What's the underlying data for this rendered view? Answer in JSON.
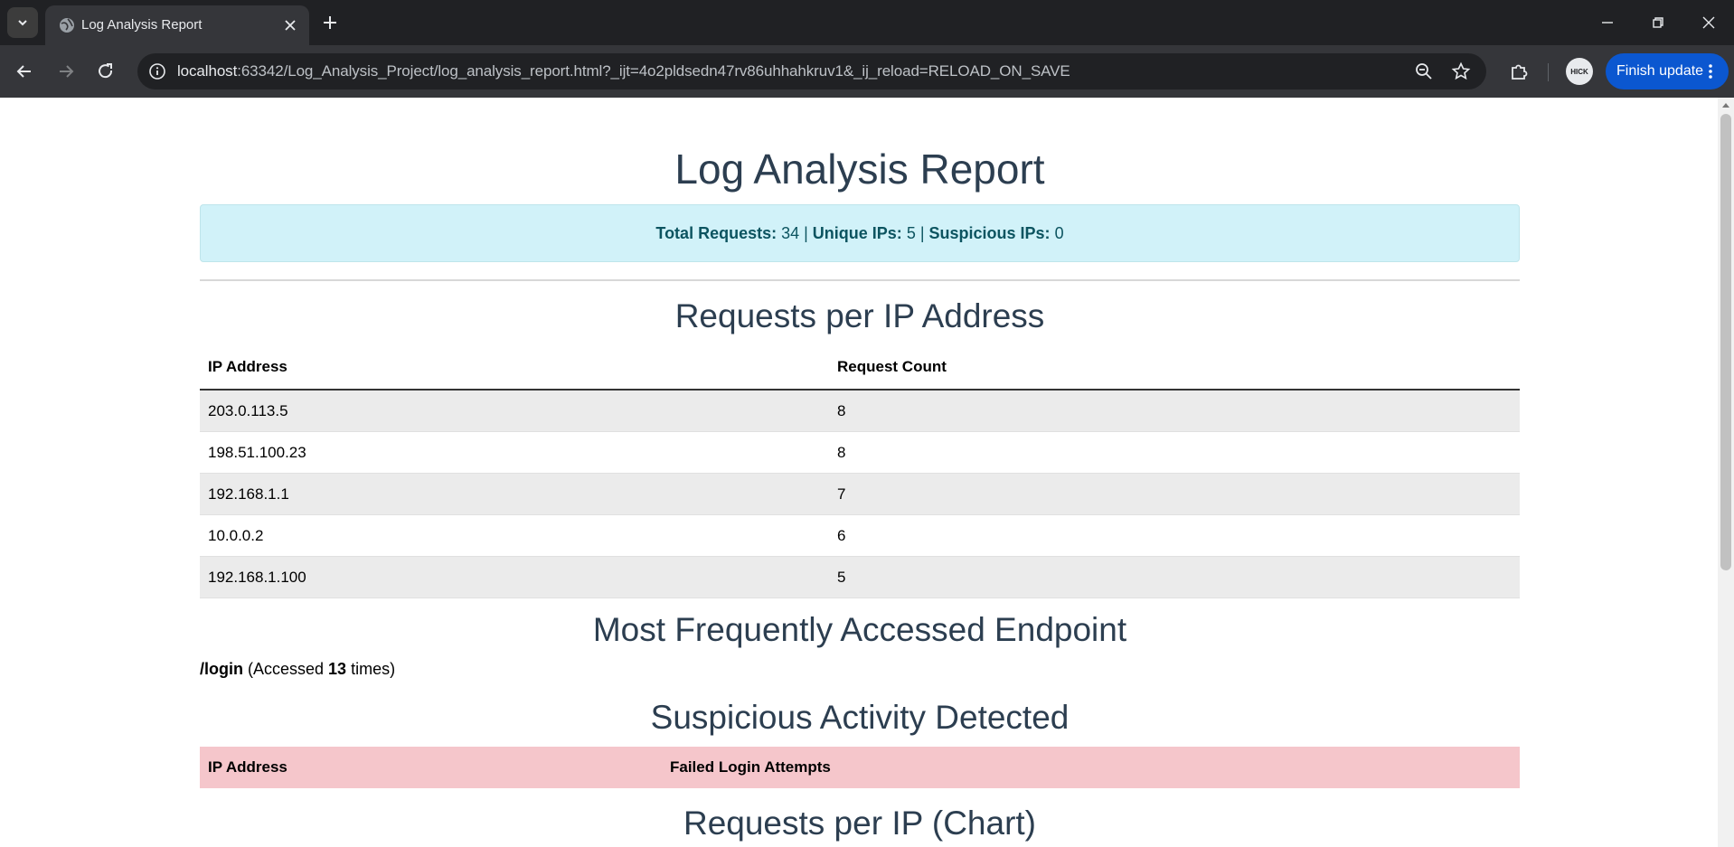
{
  "browser": {
    "tab_title": "Log Analysis Report",
    "url_host": "localhost",
    "url_rest": ":63342/Log_Analysis_Project/log_analysis_report.html?_ijt=4o2pldsedn47rv86uhhahkruv1&_ij_reload=RELOAD_ON_SAVE",
    "finish_update_label": "Finish update",
    "profile_initials": "HICK",
    "accent_color": "#0b57d0"
  },
  "report": {
    "title": "Log Analysis Report",
    "summary": {
      "total_label": "Total Requests:",
      "total_value": " 34 | ",
      "unique_label": "Unique IPs:",
      "unique_value": " 5 | ",
      "suspicious_label": "Suspicious IPs:",
      "suspicious_value": " 0"
    },
    "requests_section": {
      "heading": "Requests per IP Address",
      "columns": [
        "IP Address",
        "Request Count"
      ],
      "rows": [
        {
          "ip": "203.0.113.5",
          "count": "8"
        },
        {
          "ip": "198.51.100.23",
          "count": "8"
        },
        {
          "ip": "192.168.1.1",
          "count": "7"
        },
        {
          "ip": "10.0.0.2",
          "count": "6"
        },
        {
          "ip": "192.168.1.100",
          "count": "5"
        }
      ]
    },
    "endpoint_section": {
      "heading": "Most Frequently Accessed Endpoint",
      "endpoint": "/login",
      "text_before": " (Accessed ",
      "count": "13",
      "text_after": " times)"
    },
    "suspicious_section": {
      "heading": "Suspicious Activity Detected",
      "columns": [
        "IP Address",
        "Failed Login Attempts"
      ]
    },
    "chart_section": {
      "heading": "Requests per IP (Chart)"
    }
  }
}
